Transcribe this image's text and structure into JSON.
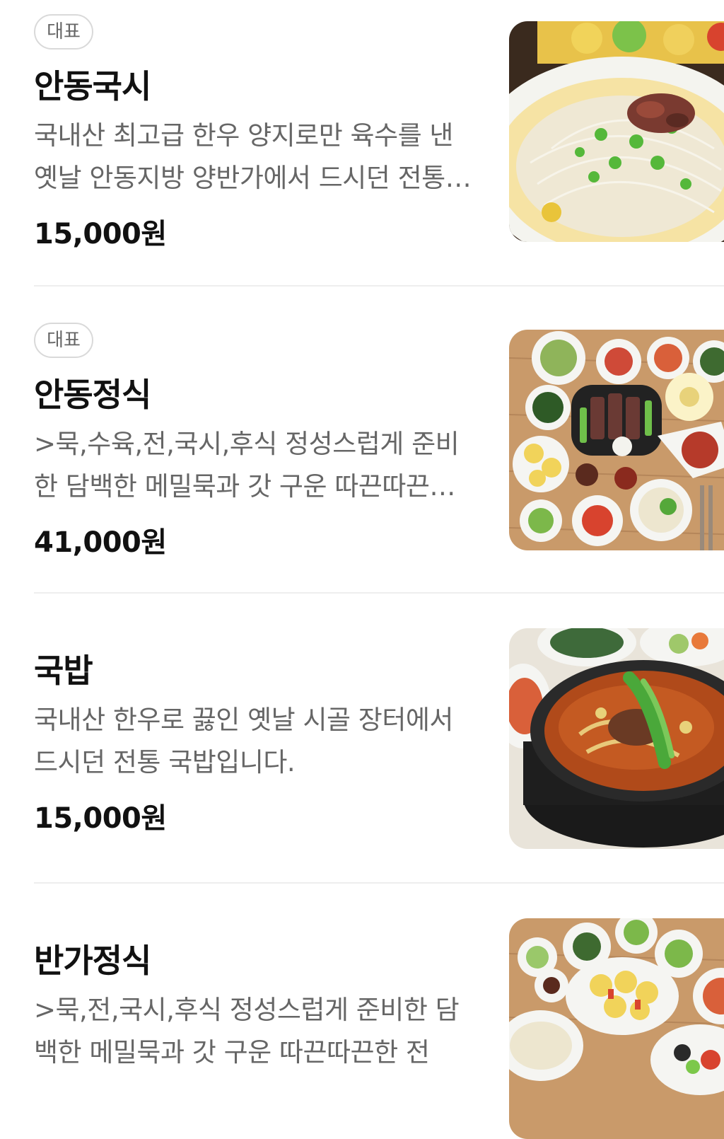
{
  "items": [
    {
      "badge": "대표",
      "name": "안동국시",
      "description": "국내산 최고급 한우 양지로만 육수를 낸 옛날 안동지방 양반가에서 드시던 전통 국수입니다.",
      "price": "15,000원",
      "image": "noodle-soup-photo"
    },
    {
      "badge": "대표",
      "name": "안동정식",
      "description": ">묵,수육,전,국시,후식 정성스럽게 준비한 담백한 메밀묵과 갓 구운 따끈따끈한 전",
      "price": "41,000원",
      "image": "korean-set-meal-photo"
    },
    {
      "name": "국밥",
      "description": "국내산 한우로 끓인 옛날 시골 장터에서 드시던 전통 국밥입니다.",
      "price": "15,000원",
      "image": "gukbap-stew-photo"
    },
    {
      "name": "반가정식",
      "description": ">묵,전,국시,후식 정성스럽게 준비한 담백한 메밀묵과 갓 구운 따끈따끈한 전",
      "image": "banga-set-meal-photo"
    }
  ]
}
